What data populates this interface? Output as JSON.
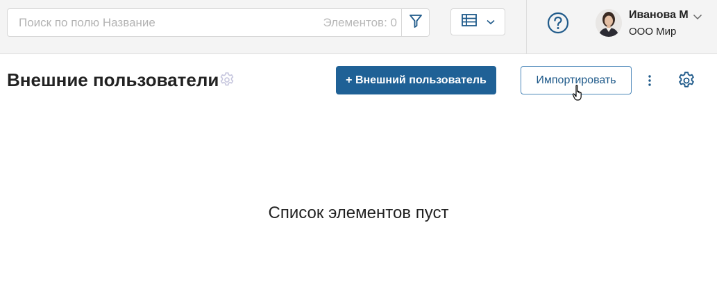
{
  "toolbar": {
    "search_placeholder": "Поиск по полю Название",
    "count_text": "Элементов: 0"
  },
  "user": {
    "name": "Иванова М",
    "org": "ООО Мир"
  },
  "page": {
    "title": "Внешние пользователи",
    "add_button": "+ Внешний пользователь",
    "import_button": "Импортировать",
    "empty_text": "Список элементов пуст"
  },
  "icons": {
    "filter": "filter-icon",
    "view": "table-view-icon",
    "help": "help-circle-icon",
    "settings": "gear-icon",
    "more": "kebab-menu-icon"
  },
  "colors": {
    "primary": "#1f6196",
    "icon_blue": "#1f5a8a",
    "muted_gear": "#c9c9e0"
  }
}
